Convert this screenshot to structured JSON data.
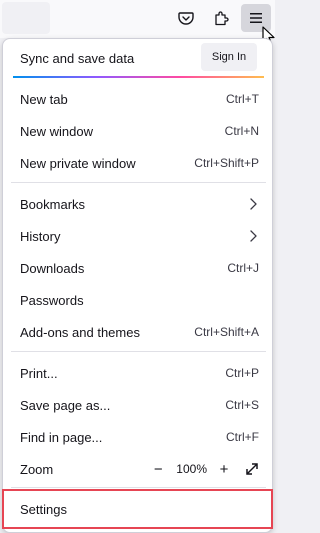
{
  "toolbar": {
    "icons": [
      "pocket-icon",
      "extensions-icon",
      "hamburger-menu-icon"
    ]
  },
  "sync": {
    "label": "Sync and save data",
    "sign_in": "Sign In"
  },
  "menu": {
    "new_tab": {
      "label": "New tab",
      "shortcut": "Ctrl+T"
    },
    "new_window": {
      "label": "New window",
      "shortcut": "Ctrl+N"
    },
    "new_private_window": {
      "label": "New private window",
      "shortcut": "Ctrl+Shift+P"
    },
    "bookmarks": {
      "label": "Bookmarks"
    },
    "history": {
      "label": "History"
    },
    "downloads": {
      "label": "Downloads",
      "shortcut": "Ctrl+J"
    },
    "passwords": {
      "label": "Passwords"
    },
    "addons": {
      "label": "Add-ons and themes",
      "shortcut": "Ctrl+Shift+A"
    },
    "print": {
      "label": "Print...",
      "shortcut": "Ctrl+P"
    },
    "save_page": {
      "label": "Save page as...",
      "shortcut": "Ctrl+S"
    },
    "find": {
      "label": "Find in page...",
      "shortcut": "Ctrl+F"
    },
    "zoom": {
      "label": "Zoom",
      "minus": "−",
      "value": "100%",
      "plus": "+"
    },
    "settings": {
      "label": "Settings"
    }
  },
  "colors": {
    "highlight": "#e64553",
    "accent_gradient": [
      "#0090ed",
      "#9059ff",
      "#ff4aa2",
      "#ffbd4f"
    ]
  }
}
